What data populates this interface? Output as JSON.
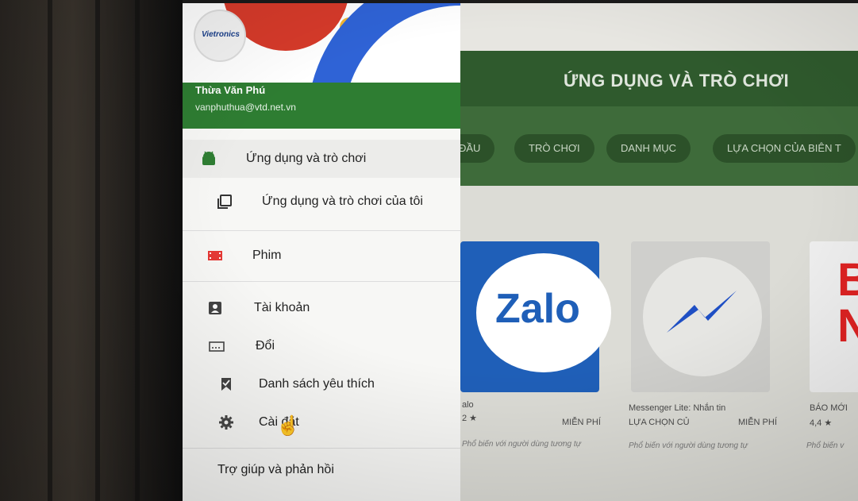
{
  "drawer": {
    "user_name": "Thừa Văn Phú",
    "user_email": "vanphuthua@vtd.net.vn",
    "avatar_text": "Vietronics",
    "items": [
      {
        "label": "Ứng dụng và trò chơi",
        "icon": "android-icon"
      },
      {
        "label": "Ứng dụng và trò chơi của tôi",
        "icon": "library-icon"
      },
      {
        "label": "Phim",
        "icon": "film-icon"
      },
      {
        "label": "Tài khoản",
        "icon": "account-icon"
      },
      {
        "label": "Đổi",
        "icon": "redeem-icon"
      },
      {
        "label": "Danh sách yêu thích",
        "icon": "wishlist-icon"
      },
      {
        "label": "Cài đặt",
        "icon": "gear-icon"
      },
      {
        "label": "Trợ giúp và phản hồi",
        "icon": ""
      }
    ]
  },
  "store": {
    "title": "ỨNG DỤNG VÀ TRÒ CHƠI",
    "tabs": [
      "ĐẦU",
      "TRÒ CHƠI",
      "DANH MỤC",
      "LỰA CHỌN CỦA BIÊN T"
    ],
    "cards": [
      {
        "name": "alo",
        "rating": "2 ★",
        "price": "MIỄN PHÍ",
        "note": "Phổ biến với người dùng tương tự",
        "logo": "Zalo"
      },
      {
        "name": "Messenger Lite: Nhắn tin",
        "rating": "LỰA CHỌN CỦ",
        "price": "MIỄN PHÍ",
        "note": "Phổ biến với người dùng tương tự"
      },
      {
        "name": "BÁO MỚI",
        "rating": "4,4 ★",
        "note": "Phổ biến v",
        "logo": "B N"
      }
    ]
  },
  "colors": {
    "accent": "#2e7d32",
    "zalo": "#1f5fb8",
    "film": "#e53935"
  }
}
